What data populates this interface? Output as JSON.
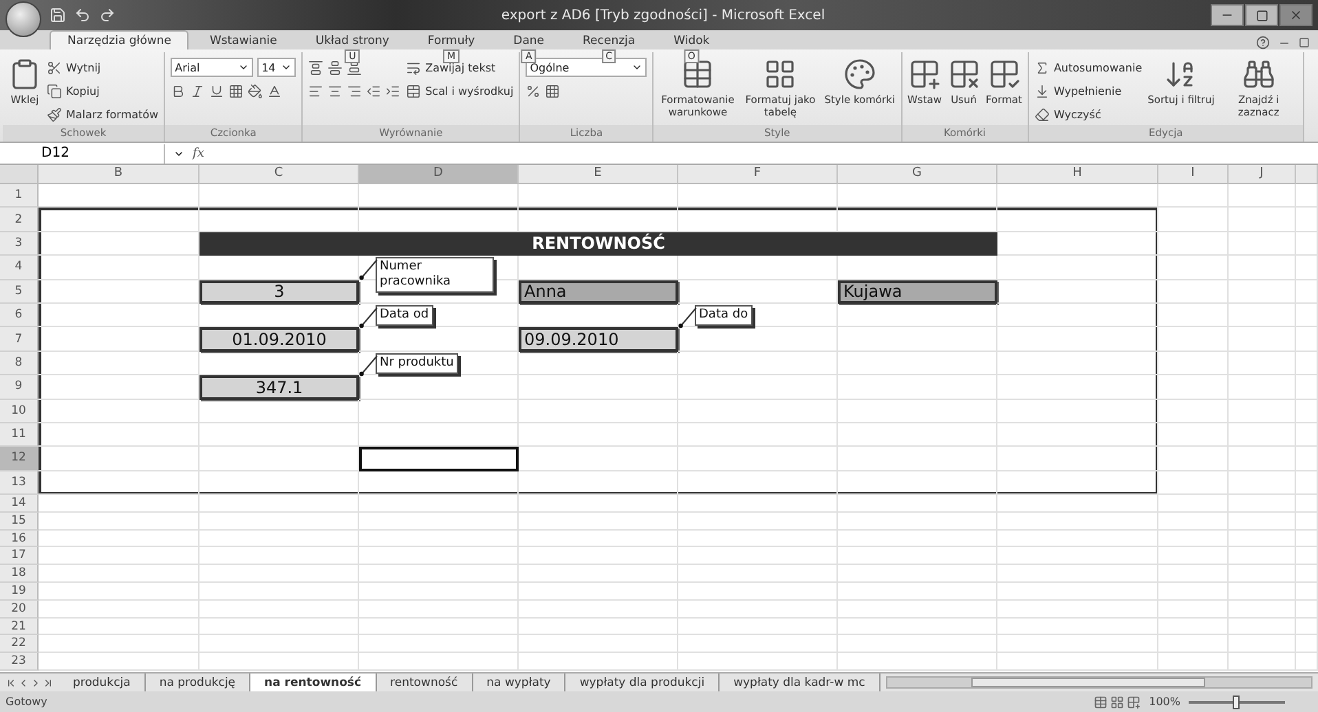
{
  "window": {
    "title": "export z AD6  [Tryb zgodności] - Microsoft Excel"
  },
  "ribbon_tabs": [
    {
      "label": "Narzędzia główne",
      "selected": true
    },
    {
      "label": "Wstawianie",
      "selected": false
    },
    {
      "label": "Układ strony",
      "key_tip": "U",
      "selected": false
    },
    {
      "label": "Formuły",
      "key_tip": "M",
      "selected": false
    },
    {
      "label": "Dane",
      "key_tip": "A",
      "selected": false
    },
    {
      "label": "Recenzja",
      "key_tip": "C",
      "selected": false
    },
    {
      "label": "Widok",
      "key_tip": "O",
      "selected": false
    }
  ],
  "ribbon_groups": [
    {
      "label": "Schowek",
      "items": [
        {
          "kind": "large",
          "label": "Wklej"
        },
        {
          "kind": "small",
          "label": "Wytnij"
        },
        {
          "kind": "small",
          "label": "Kopiuj"
        },
        {
          "kind": "small",
          "label": "Malarz formatów"
        }
      ]
    },
    {
      "label": "Czcionka",
      "items": [
        {
          "kind": "font",
          "font": "Arial",
          "size": "14"
        }
      ]
    },
    {
      "label": "Wyrównanie",
      "items": [
        {
          "kind": "align"
        },
        {
          "kind": "small",
          "label": "Zawijaj tekst"
        },
        {
          "kind": "small",
          "label": "Scal i wyśrodkuj"
        }
      ]
    },
    {
      "label": "Liczba",
      "items": [
        {
          "kind": "number",
          "value": "Ogólne"
        }
      ]
    },
    {
      "label": "Style",
      "items": [
        {
          "kind": "large",
          "label": "Formatowanie warunkowe"
        },
        {
          "kind": "large",
          "label": "Formatuj jako tabelę"
        },
        {
          "kind": "large",
          "label": "Style komórki"
        }
      ]
    },
    {
      "label": "Komórki",
      "items": [
        {
          "kind": "large",
          "label": "Wstaw"
        },
        {
          "kind": "large",
          "label": "Usuń"
        },
        {
          "kind": "large",
          "label": "Format"
        }
      ]
    },
    {
      "label": "Edycja",
      "items": [
        {
          "kind": "small",
          "label": "Autosumowanie"
        },
        {
          "kind": "small",
          "label": "Wypełnienie"
        },
        {
          "kind": "small",
          "label": "Wyczyść"
        },
        {
          "kind": "large",
          "label": "Sortuj i filtruj"
        },
        {
          "kind": "large",
          "label": "Znajdź i zaznacz"
        }
      ]
    }
  ],
  "formula_bar": {
    "name_box": "D12",
    "function_label": "fx"
  },
  "columns": [
    {
      "label": "B",
      "selected": false
    },
    {
      "label": "C",
      "selected": false
    },
    {
      "label": "D",
      "selected": true
    },
    {
      "label": "E",
      "selected": false
    },
    {
      "label": "F",
      "selected": false
    },
    {
      "label": "G",
      "selected": false
    },
    {
      "label": "H",
      "selected": false
    },
    {
      "label": "I",
      "selected": false
    },
    {
      "label": "J",
      "selected": false
    }
  ],
  "rows": [
    {
      "label": "1",
      "selected": false
    },
    {
      "label": "2",
      "selected": false
    },
    {
      "label": "3",
      "selected": false,
      "cells": [
        {},
        {
          "kind": "header",
          "value": "RENTOWNOŚĆ"
        },
        {
          "kind": "merged"
        },
        {
          "kind": "merged"
        },
        {
          "kind": "merged"
        },
        {
          "kind": "merged"
        },
        {},
        {},
        {}
      ]
    },
    {
      "label": "4",
      "selected": false,
      "cells": [
        {},
        {},
        {
          "comment": "Numer pracownika"
        },
        {},
        {},
        {},
        {},
        {},
        {}
      ]
    },
    {
      "label": "5",
      "selected": false,
      "cells": [
        {},
        {
          "kind": "number",
          "color": "#d4d4d4",
          "value": "3"
        },
        {},
        {
          "kind": "text",
          "color": "#a9a9a9",
          "value": "Anna"
        },
        {},
        {
          "kind": "text",
          "color": "#a9a9a9",
          "value": "Kujawa"
        },
        {},
        {},
        {}
      ]
    },
    {
      "label": "6",
      "selected": false,
      "cells": [
        {},
        {},
        {
          "comment": "Data od"
        },
        {},
        {
          "comment": "Data do"
        },
        {},
        {},
        {},
        {}
      ]
    },
    {
      "label": "7",
      "selected": false,
      "cells": [
        {},
        {
          "kind": "number",
          "color": "#d4d4d4",
          "value": "01.09.2010"
        },
        {},
        {
          "kind": "text",
          "color": "#d4d4d4",
          "value": "09.09.2010"
        },
        {},
        {},
        {},
        {},
        {}
      ]
    },
    {
      "label": "8",
      "selected": false,
      "cells": [
        {},
        {},
        {
          "comment": "Nr produktu"
        },
        {},
        {},
        {},
        {},
        {},
        {}
      ]
    },
    {
      "label": "9",
      "selected": false,
      "cells": [
        {},
        {
          "kind": "number",
          "color": "#d4d4d4",
          "value": "347.1"
        },
        {},
        {},
        {},
        {},
        {},
        {},
        {}
      ]
    },
    {
      "label": "10",
      "selected": false
    },
    {
      "label": "11",
      "selected": false
    },
    {
      "label": "12",
      "selected": true
    },
    {
      "label": "13",
      "selected": false
    },
    {
      "label": "14",
      "selected": false
    },
    {
      "label": "15",
      "selected": false
    },
    {
      "label": "16",
      "selected": false
    },
    {
      "label": "17",
      "selected": false
    },
    {
      "label": "18",
      "selected": false
    },
    {
      "label": "19",
      "selected": false
    },
    {
      "label": "20",
      "selected": false
    },
    {
      "label": "21",
      "selected": false
    },
    {
      "label": "22",
      "selected": false
    },
    {
      "label": "23",
      "selected": false
    }
  ],
  "sheet_tabs": [
    {
      "label": "produkcja",
      "selected": false
    },
    {
      "label": "na produkcję",
      "selected": false
    },
    {
      "label": "na rentowność",
      "selected": true
    },
    {
      "label": "rentowność",
      "selected": false
    },
    {
      "label": "na wypłaty",
      "selected": false
    },
    {
      "label": "wypłaty dla produkcji",
      "selected": false
    },
    {
      "label": "wypłaty dla kadr-w mc",
      "selected": false
    }
  ],
  "status_bar": {
    "status": "Gotowy",
    "zoom": "100%",
    "zoom_slider": {
      "level": 0.5
    }
  }
}
